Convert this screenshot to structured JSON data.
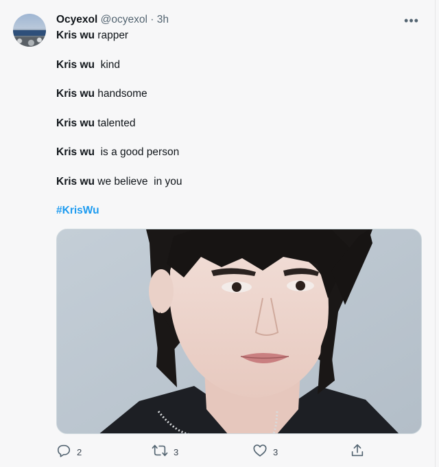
{
  "tweet": {
    "author": {
      "name": "Ocyexol",
      "handle": "@ocyexol",
      "separator": "·",
      "time": "3h"
    },
    "lines": [
      {
        "name": "Kris wu",
        "text": " rapper"
      },
      {
        "name": "Kris wu",
        "text": "  kind"
      },
      {
        "name": "Kris wu",
        "text": " handsome"
      },
      {
        "name": "Kris wu",
        "text": " talented"
      },
      {
        "name": "Kris wu",
        "text": "  is a good person"
      },
      {
        "name": "Kris wu",
        "text": " we believe  in you"
      }
    ],
    "hashtag": "#KrisWu",
    "more_label": "•••",
    "actions": {
      "replies": "2",
      "retweets": "3",
      "likes": "3"
    }
  },
  "colors": {
    "link": "#1d9bf0",
    "text": "#0f1419",
    "muted": "#536471",
    "background": "#f7f7f8"
  },
  "icons": [
    "more-icon",
    "reply-icon",
    "retweet-icon",
    "like-icon",
    "share-icon"
  ]
}
